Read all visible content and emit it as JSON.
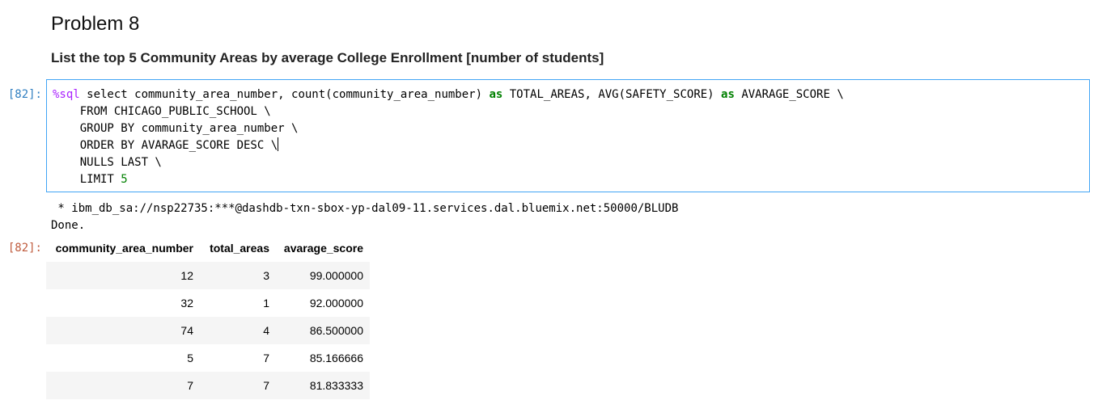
{
  "markdown": {
    "heading": "Problem 8",
    "description": "List the top 5 Community Areas by average College Enrollment [number of students]"
  },
  "code_cell": {
    "prompt": "[82]:",
    "lines": [
      [
        {
          "t": "%sql",
          "c": "magic"
        },
        {
          "t": " select community_area_number, count(community_area_number) ",
          "c": ""
        },
        {
          "t": "as",
          "c": "kw"
        },
        {
          "t": " TOTAL_AREAS, AVG(SAFETY_SCORE) ",
          "c": ""
        },
        {
          "t": "as",
          "c": "kw"
        },
        {
          "t": " AVARAGE_SCORE \\",
          "c": ""
        }
      ],
      [
        {
          "t": "    FROM CHICAGO_PUBLIC_SCHOOL \\",
          "c": ""
        }
      ],
      [
        {
          "t": "    GROUP BY community_area_number \\",
          "c": ""
        }
      ],
      [
        {
          "t": "    ORDER BY AVARAGE_SCORE DESC \\",
          "c": ""
        },
        {
          "t": "",
          "c": "cursor"
        }
      ],
      [
        {
          "t": "    NULLS LAST \\",
          "c": ""
        }
      ],
      [
        {
          "t": "    LIMIT ",
          "c": ""
        },
        {
          "t": "5",
          "c": "num"
        }
      ]
    ]
  },
  "output": {
    "stdout_lines": [
      " * ibm_db_sa://nsp22735:***@dashdb-txn-sbox-yp-dal09-11.services.dal.bluemix.net:50000/BLUDB",
      "Done."
    ],
    "prompt": "[82]:",
    "table": {
      "columns": [
        "community_area_number",
        "total_areas",
        "avarage_score"
      ],
      "rows": [
        [
          "12",
          "3",
          "99.000000"
        ],
        [
          "32",
          "1",
          "92.000000"
        ],
        [
          "74",
          "4",
          "86.500000"
        ],
        [
          "5",
          "7",
          "85.166666"
        ],
        [
          "7",
          "7",
          "81.833333"
        ]
      ]
    }
  },
  "colors": {
    "in_prompt": "#307fc1",
    "out_prompt": "#bf5b3d",
    "selected_cell_border": "#42a5f5",
    "sql_magic": "#aa22ff",
    "sql_keyword": "#008000",
    "row_stripe": "#f5f5f5"
  }
}
